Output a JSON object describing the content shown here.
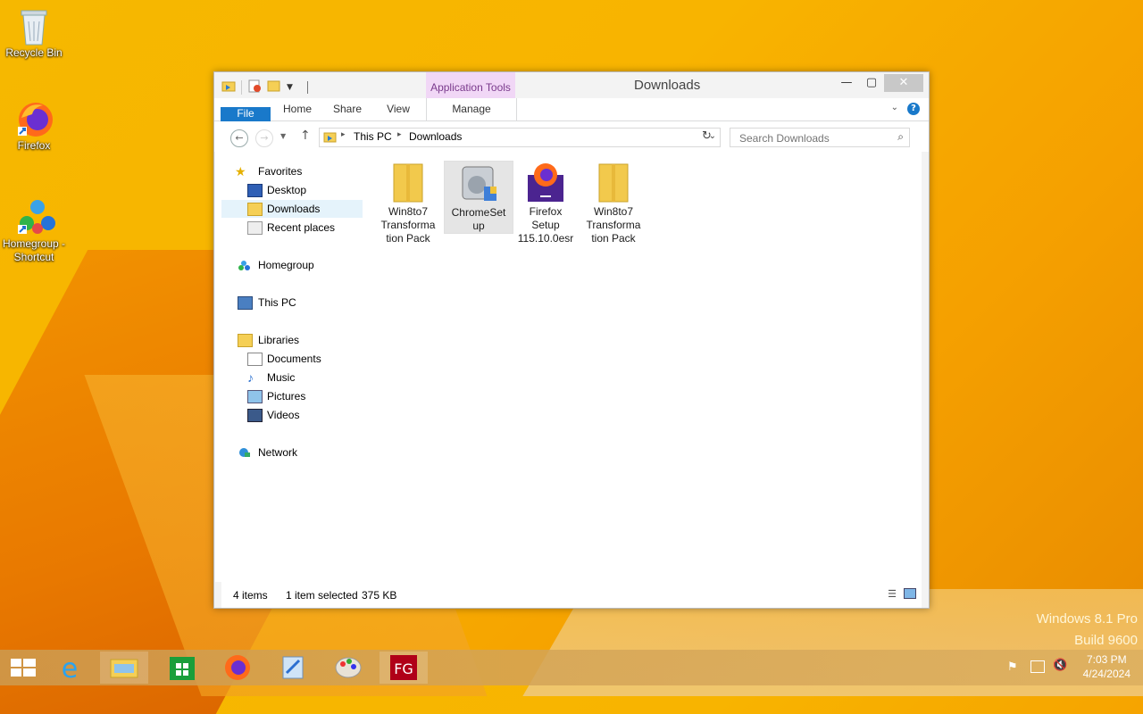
{
  "desktop": {
    "icons": [
      {
        "label": "Recycle Bin"
      },
      {
        "label": "Firefox"
      },
      {
        "label": "Homegroup - Shortcut"
      }
    ],
    "brand_line1": "Windows 8.1 Pro",
    "brand_line2": "Build 9600"
  },
  "window": {
    "title": "Downloads",
    "context_tab": "Application Tools",
    "ribbon_tabs": [
      "File",
      "Home",
      "Share",
      "View",
      "Manage"
    ],
    "address": {
      "crumbs": [
        "This PC",
        "Downloads"
      ]
    },
    "search": {
      "placeholder": "Search Downloads"
    },
    "nav": {
      "favorites": "Favorites",
      "desktop": "Desktop",
      "downloads": "Downloads",
      "recent": "Recent places",
      "homegroup": "Homegroup",
      "this_pc": "This PC",
      "libraries": "Libraries",
      "documents": "Documents",
      "music": "Music",
      "pictures": "Pictures",
      "videos": "Videos",
      "network": "Network"
    },
    "files": [
      {
        "name": "Win8to7 Transformation Pack",
        "line1": "Win8to7",
        "line2": "Transforma",
        "line3": "tion Pack"
      },
      {
        "name": "ChromeSetup",
        "line1": "ChromeSet",
        "line2": "up",
        "line3": ""
      },
      {
        "name": "Firefox Setup 115.10.0esr",
        "line1": "Firefox",
        "line2": "Setup",
        "line3": "115.10.0esr"
      },
      {
        "name": "Win8to7 Transformation Pack",
        "line1": "Win8to7",
        "line2": "Transforma",
        "line3": "tion Pack"
      }
    ],
    "status": {
      "items": "4 items",
      "selected": "1 item selected",
      "size": "375 KB"
    }
  },
  "taskbar": {
    "time": "7:03 PM",
    "date": "4/24/2024"
  }
}
